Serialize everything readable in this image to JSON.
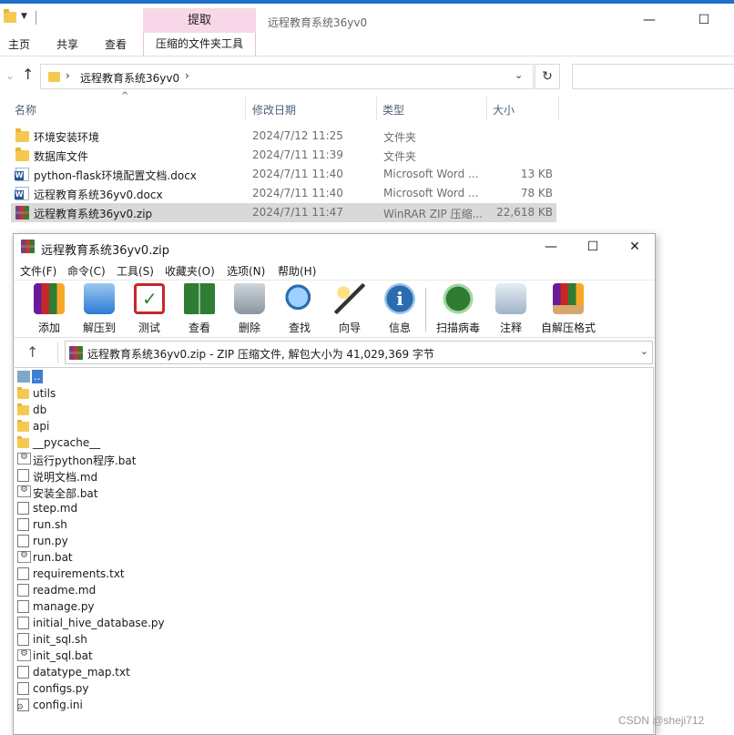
{
  "explorer": {
    "context_tab_header": "提取",
    "window_title": "远程教育系统36yv0",
    "ribbon_tabs": [
      "主页",
      "共享",
      "查看",
      "压缩的文件夹工具"
    ],
    "address": {
      "path": "远程教育系统36yv0"
    },
    "columns": {
      "name": "名称",
      "date": "修改日期",
      "type": "类型",
      "size": "大小"
    },
    "files": [
      {
        "icon": "folder-icon",
        "name": "环境安装环境",
        "date": "2024/7/12 11:25",
        "type": "文件夹",
        "size": ""
      },
      {
        "icon": "folder-icon",
        "name": "数据库文件",
        "date": "2024/7/11 11:39",
        "type": "文件夹",
        "size": ""
      },
      {
        "icon": "word-doc-icon",
        "name": "python-flask环境配置文档.docx",
        "date": "2024/7/11 11:40",
        "type": "Microsoft Word ...",
        "size": "13 KB"
      },
      {
        "icon": "word-doc-icon",
        "name": "远程教育系统36yv0.docx",
        "date": "2024/7/11 11:40",
        "type": "Microsoft Word ...",
        "size": "78 KB"
      },
      {
        "icon": "winrar-archive-icon",
        "name": "远程教育系统36yv0.zip",
        "date": "2024/7/11 11:47",
        "type": "WinRAR ZIP 压缩...",
        "size": "22,618 KB",
        "selected": true
      }
    ]
  },
  "winrar": {
    "title": "远程教育系统36yv0.zip",
    "menu": [
      "文件(F)",
      "命令(C)",
      "工具(S)",
      "收藏夹(O)",
      "选项(N)",
      "帮助(H)"
    ],
    "toolbar": [
      {
        "label": "添加",
        "icon": "add-icon"
      },
      {
        "label": "解压到",
        "icon": "extract-to-icon"
      },
      {
        "label": "测试",
        "icon": "test-icon"
      },
      {
        "label": "查看",
        "icon": "view-icon"
      },
      {
        "label": "删除",
        "icon": "delete-icon"
      },
      {
        "label": "查找",
        "icon": "find-icon"
      },
      {
        "label": "向导",
        "icon": "wizard-icon"
      },
      {
        "label": "信息",
        "icon": "info-icon"
      },
      {
        "label": "扫描病毒",
        "icon": "scan-virus-icon"
      },
      {
        "label": "注释",
        "icon": "comment-icon"
      },
      {
        "label": "自解压格式",
        "icon": "sfx-icon"
      }
    ],
    "path_bar": "远程教育系统36yv0.zip - ZIP 压缩文件, 解包大小为 41,029,369 字节",
    "items": [
      {
        "name": "..",
        "kind": "up"
      },
      {
        "name": "utils",
        "kind": "folder"
      },
      {
        "name": "db",
        "kind": "folder"
      },
      {
        "name": "api",
        "kind": "folder"
      },
      {
        "name": "__pycache__",
        "kind": "folder"
      },
      {
        "name": "运行python程序.bat",
        "kind": "bat"
      },
      {
        "name": "说明文档.md",
        "kind": "file"
      },
      {
        "name": "安装全部.bat",
        "kind": "bat"
      },
      {
        "name": "step.md",
        "kind": "file"
      },
      {
        "name": "run.sh",
        "kind": "file"
      },
      {
        "name": "run.py",
        "kind": "file"
      },
      {
        "name": "run.bat",
        "kind": "bat"
      },
      {
        "name": "requirements.txt",
        "kind": "file"
      },
      {
        "name": "readme.md",
        "kind": "file"
      },
      {
        "name": "manage.py",
        "kind": "file"
      },
      {
        "name": "initial_hive_database.py",
        "kind": "file"
      },
      {
        "name": "init_sql.sh",
        "kind": "file"
      },
      {
        "name": "init_sql.bat",
        "kind": "bat"
      },
      {
        "name": "datatype_map.txt",
        "kind": "file"
      },
      {
        "name": "configs.py",
        "kind": "file"
      },
      {
        "name": "config.ini",
        "kind": "ini"
      }
    ]
  },
  "watermark": "CSDN @sheji712"
}
